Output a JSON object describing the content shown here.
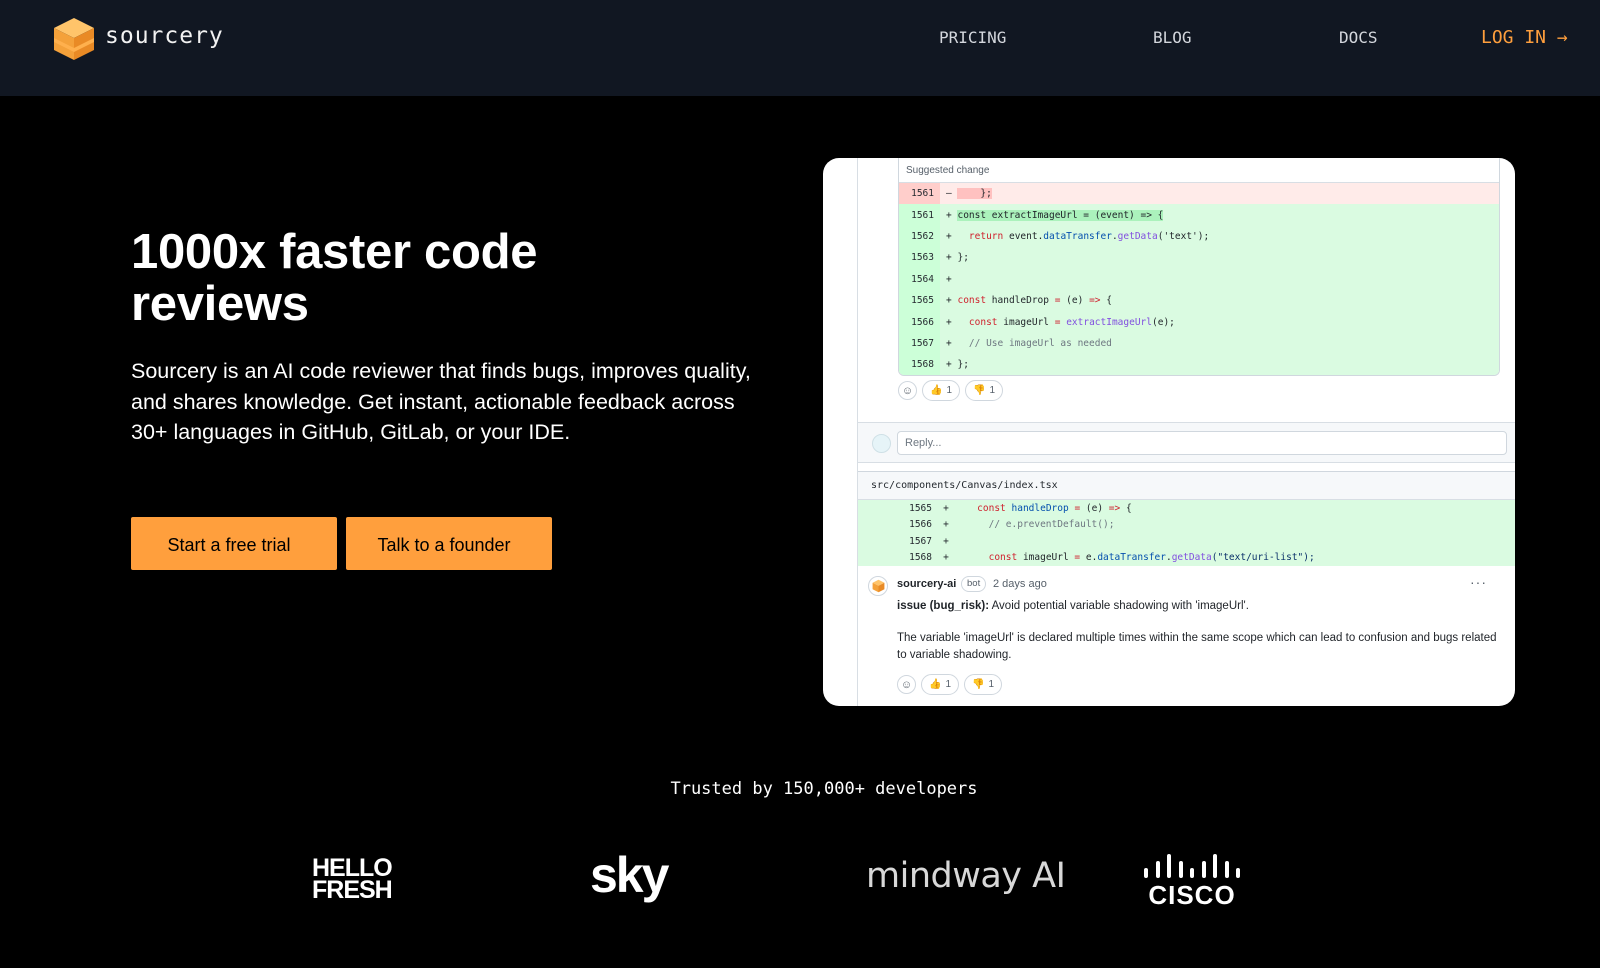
{
  "nav": {
    "brand": "sourcery",
    "links": [
      "PRICING",
      "BLOG",
      "DOCS"
    ],
    "login": "LOG IN →"
  },
  "hero": {
    "title": "1000x faster code reviews",
    "description": "Sourcery is an AI code reviewer that finds bugs, improves quality, and shares knowledge. Get instant, actionable feedback across 30+ languages in GitHub, GitLab, or your IDE.",
    "cta_trial": "Start a free trial",
    "cta_founder": "Talk to a founder"
  },
  "review": {
    "suggestion_header": "Suggested change",
    "lines": [
      {
        "n": "1561",
        "sign": "–",
        "type": "del"
      },
      {
        "n": "1561",
        "sign": "+",
        "type": "add"
      },
      {
        "n": "1562",
        "sign": "+",
        "type": "add"
      },
      {
        "n": "1563",
        "sign": "+",
        "type": "add"
      },
      {
        "n": "1564",
        "sign": "+",
        "type": "add"
      },
      {
        "n": "1565",
        "sign": "+",
        "type": "add"
      },
      {
        "n": "1566",
        "sign": "+",
        "type": "add"
      },
      {
        "n": "1567",
        "sign": "+",
        "type": "add"
      },
      {
        "n": "1568",
        "sign": "+",
        "type": "add"
      }
    ],
    "code": {
      "del_1561": "    };",
      "add_1561": "const extractImageUrl = (event) => {",
      "l1562_a": "  ",
      "l1562_ret": "return",
      "l1562_b": " event.",
      "l1562_fn1": "dataTransfer",
      "l1562_c": ".",
      "l1562_fn2": "getData",
      "l1562_d": "('text');",
      "l1563": "};",
      "l1565_const": "const",
      "l1565_a": " handleDrop ",
      "l1565_eq": "=",
      "l1565_b": " (e) ",
      "l1565_arrow": "=>",
      "l1565_c": " {",
      "l1566_a": "  ",
      "l1566_const": "const",
      "l1566_b": " imageUrl ",
      "l1566_eq": "=",
      "l1566_c": " ",
      "l1566_fn": "extractImageUrl",
      "l1566_d": "(e);",
      "l1567": "  // Use imageUrl as needed",
      "l1568": "};"
    },
    "reactions": {
      "thumbs_up": "👍",
      "thumbs_up_count": "1",
      "thumbs_down": "👎",
      "thumbs_down_count": "1",
      "smile": "☺"
    },
    "reply_placeholder": "Reply...",
    "file_path": "src/components/Canvas/index.tsx",
    "file_lines": [
      {
        "n": "1565",
        "sign": "+"
      },
      {
        "n": "1566",
        "sign": "+"
      },
      {
        "n": "1567",
        "sign": "+"
      },
      {
        "n": "1568",
        "sign": "+"
      }
    ],
    "file_code": {
      "f1565_a": "   ",
      "f1565_const": "const",
      "f1565_b": " ",
      "f1565_fn": "handleDrop",
      "f1565_c": " ",
      "f1565_eq": "=",
      "f1565_d": " (e) ",
      "f1565_arrow": "=>",
      "f1565_e": " {",
      "f1566": "     // e.preventDefault();",
      "f1568_a": "     ",
      "f1568_const": "const",
      "f1568_b": " imageUrl ",
      "f1568_eq": "=",
      "f1568_c": " e.",
      "f1568_fn1": "dataTransfer",
      "f1568_d": ".",
      "f1568_fn2": "getData",
      "f1568_e": "(\"text/uri-list\");"
    },
    "comment": {
      "author": "sourcery-ai",
      "badge": "bot",
      "time": "2 days ago",
      "more": "···",
      "issue_label": "issue (bug_risk):",
      "issue_text": " Avoid potential variable shadowing with 'imageUrl'.",
      "body": "The variable 'imageUrl' is declared multiple times within the same scope which can lead to confusion and bugs related to variable shadowing."
    }
  },
  "trusted": {
    "heading": "Trusted by 150,000+ developers",
    "logos": {
      "hellofresh_1": "HELLO",
      "hellofresh_2": "FRESH",
      "sky": "sky",
      "mindway": "mindway AI",
      "cisco": "CISCO"
    }
  },
  "colors": {
    "accent": "#ff9f3d",
    "nav_bg": "#111722",
    "add_bg": "#dafbe1",
    "del_bg": "#ffebe9"
  }
}
